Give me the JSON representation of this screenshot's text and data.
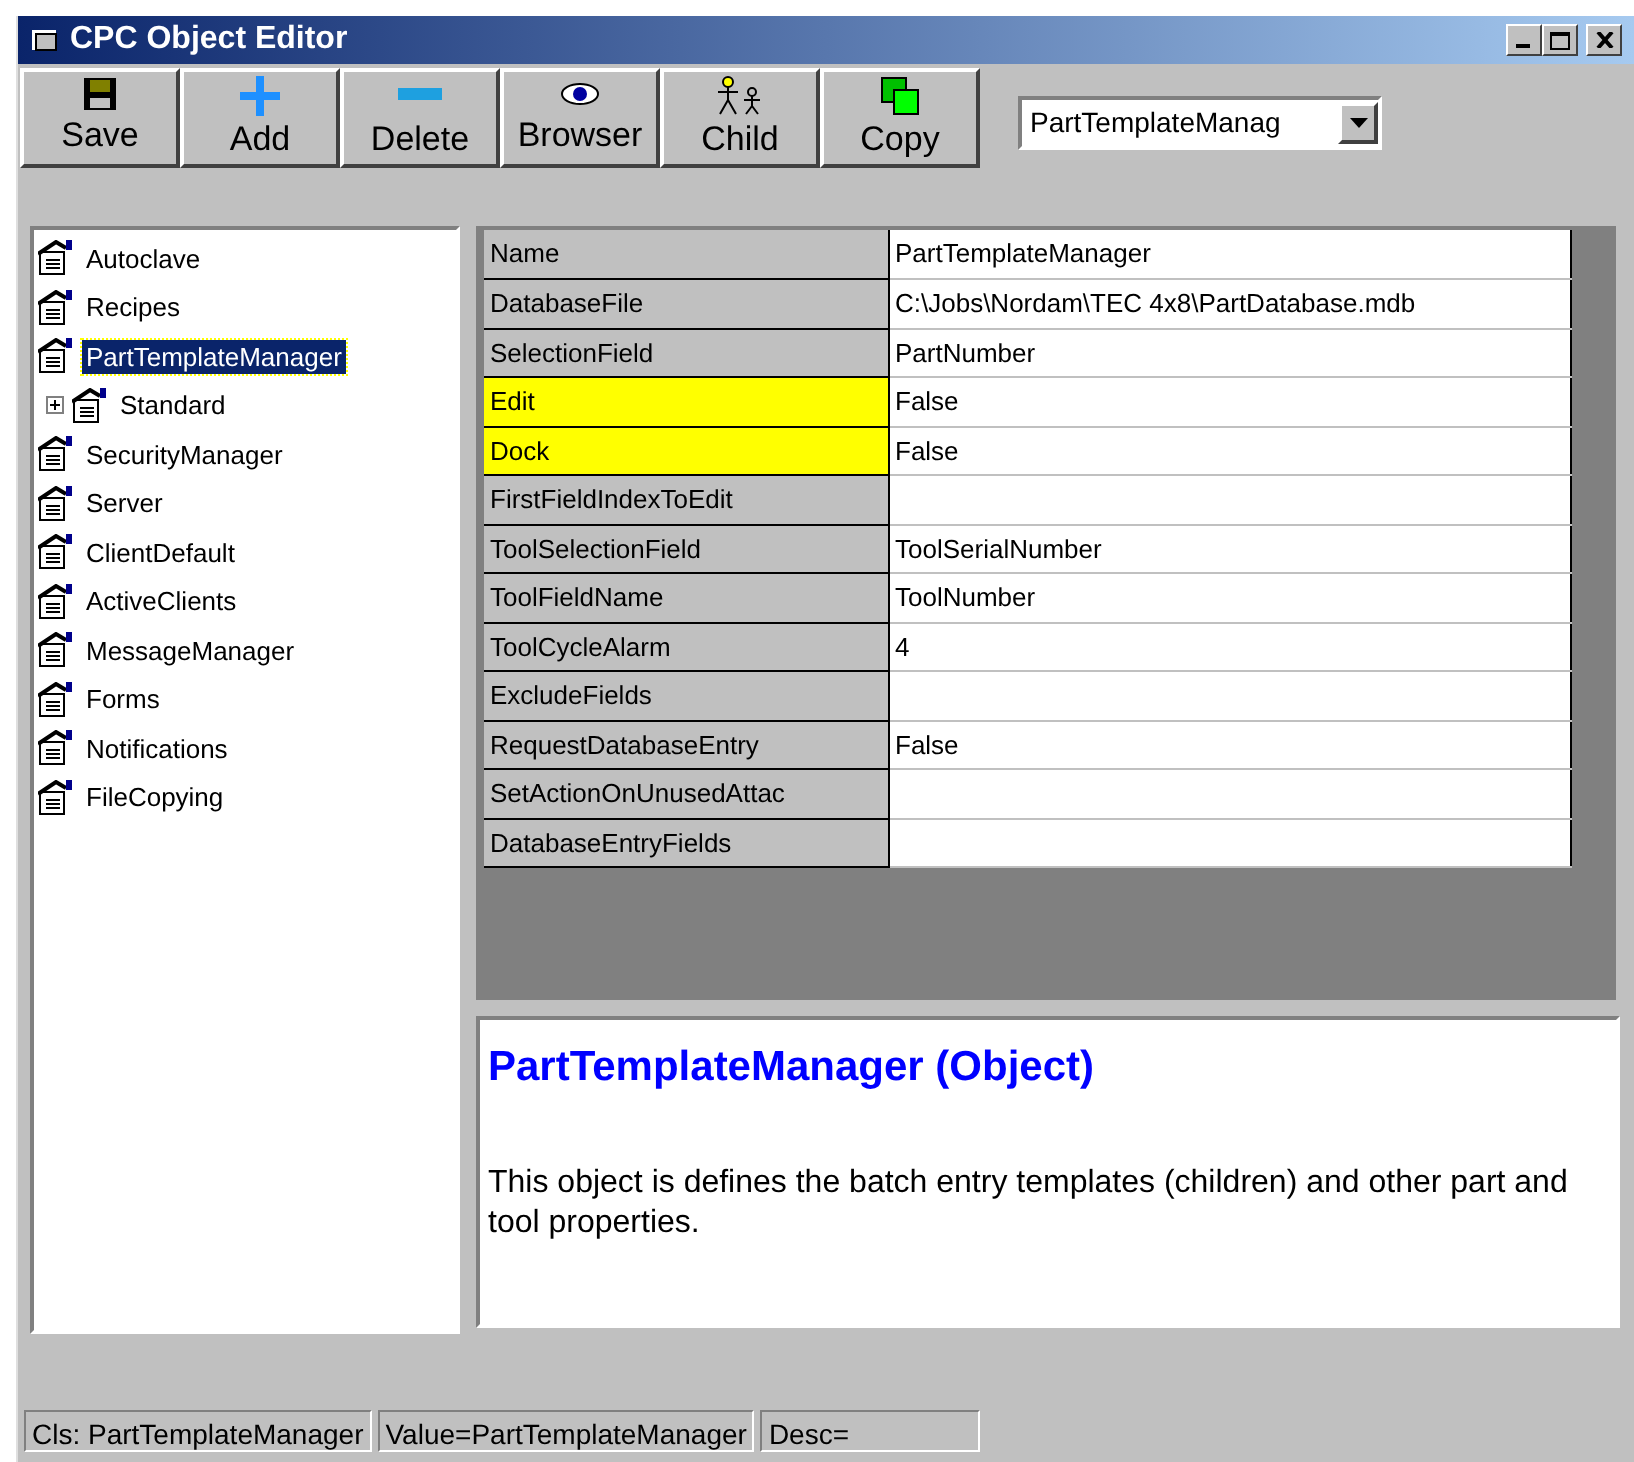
{
  "window": {
    "title": "CPC Object Editor"
  },
  "toolbar": [
    {
      "label": "Save",
      "kind": "save"
    },
    {
      "label": "Add",
      "kind": "add"
    },
    {
      "label": "Delete",
      "kind": "delete"
    },
    {
      "label": "Browser",
      "kind": "browser"
    },
    {
      "label": "Child",
      "kind": "child"
    },
    {
      "label": "Copy",
      "kind": "copy"
    }
  ],
  "object_combo": {
    "value": "PartTemplateManag"
  },
  "tree": [
    {
      "label": "Autoclave",
      "selected": false
    },
    {
      "label": "Recipes",
      "selected": false
    },
    {
      "label": "PartTemplateManager",
      "selected": true,
      "children": [
        {
          "label": "Standard",
          "selected": false,
          "expanded": false
        }
      ]
    },
    {
      "label": "SecurityManager",
      "selected": false
    },
    {
      "label": "Server",
      "selected": false
    },
    {
      "label": "ClientDefault",
      "selected": false
    },
    {
      "label": "ActiveClients",
      "selected": false
    },
    {
      "label": "MessageManager",
      "selected": false
    },
    {
      "label": "Forms",
      "selected": false
    },
    {
      "label": "Notifications",
      "selected": false
    },
    {
      "label": "FileCopying",
      "selected": false
    }
  ],
  "properties": [
    {
      "name": "Name",
      "value": "PartTemplateManager",
      "highlighted": false
    },
    {
      "name": "DatabaseFile",
      "value": "C:\\Jobs\\Nordam\\TEC 4x8\\PartDatabase.mdb",
      "highlighted": false
    },
    {
      "name": "SelectionField",
      "value": "PartNumber",
      "highlighted": false
    },
    {
      "name": "Edit",
      "value": "False",
      "highlighted": true
    },
    {
      "name": "Dock",
      "value": "False",
      "highlighted": true
    },
    {
      "name": "FirstFieldIndexToEdit",
      "highlighted": false
    },
    {
      "name": "ToolSelectionField",
      "value": "ToolSerialNumber",
      "highlighted": false
    },
    {
      "name": "ToolFieldName",
      "value": "ToolNumber",
      "highlighted": false
    },
    {
      "name": "ToolCycleAlarm",
      "value": "4",
      "highlighted": false
    },
    {
      "name": "ExcludeFields",
      "highlighted": false
    },
    {
      "name": "RequestDatabaseEntry",
      "value": "False",
      "highlighted": false
    },
    {
      "name": "SetActionOnUnusedAttac",
      "highlighted": false
    },
    {
      "name": "DatabaseEntryFields",
      "highlighted": false
    }
  ],
  "description": {
    "title": "PartTemplateManager (Object)",
    "text": "This object is defines the batch entry templates (children) and other part and tool properties."
  },
  "status_bar": [
    "Cls: PartTemplateManager",
    "Value=PartTemplateManager",
    "Desc="
  ]
}
